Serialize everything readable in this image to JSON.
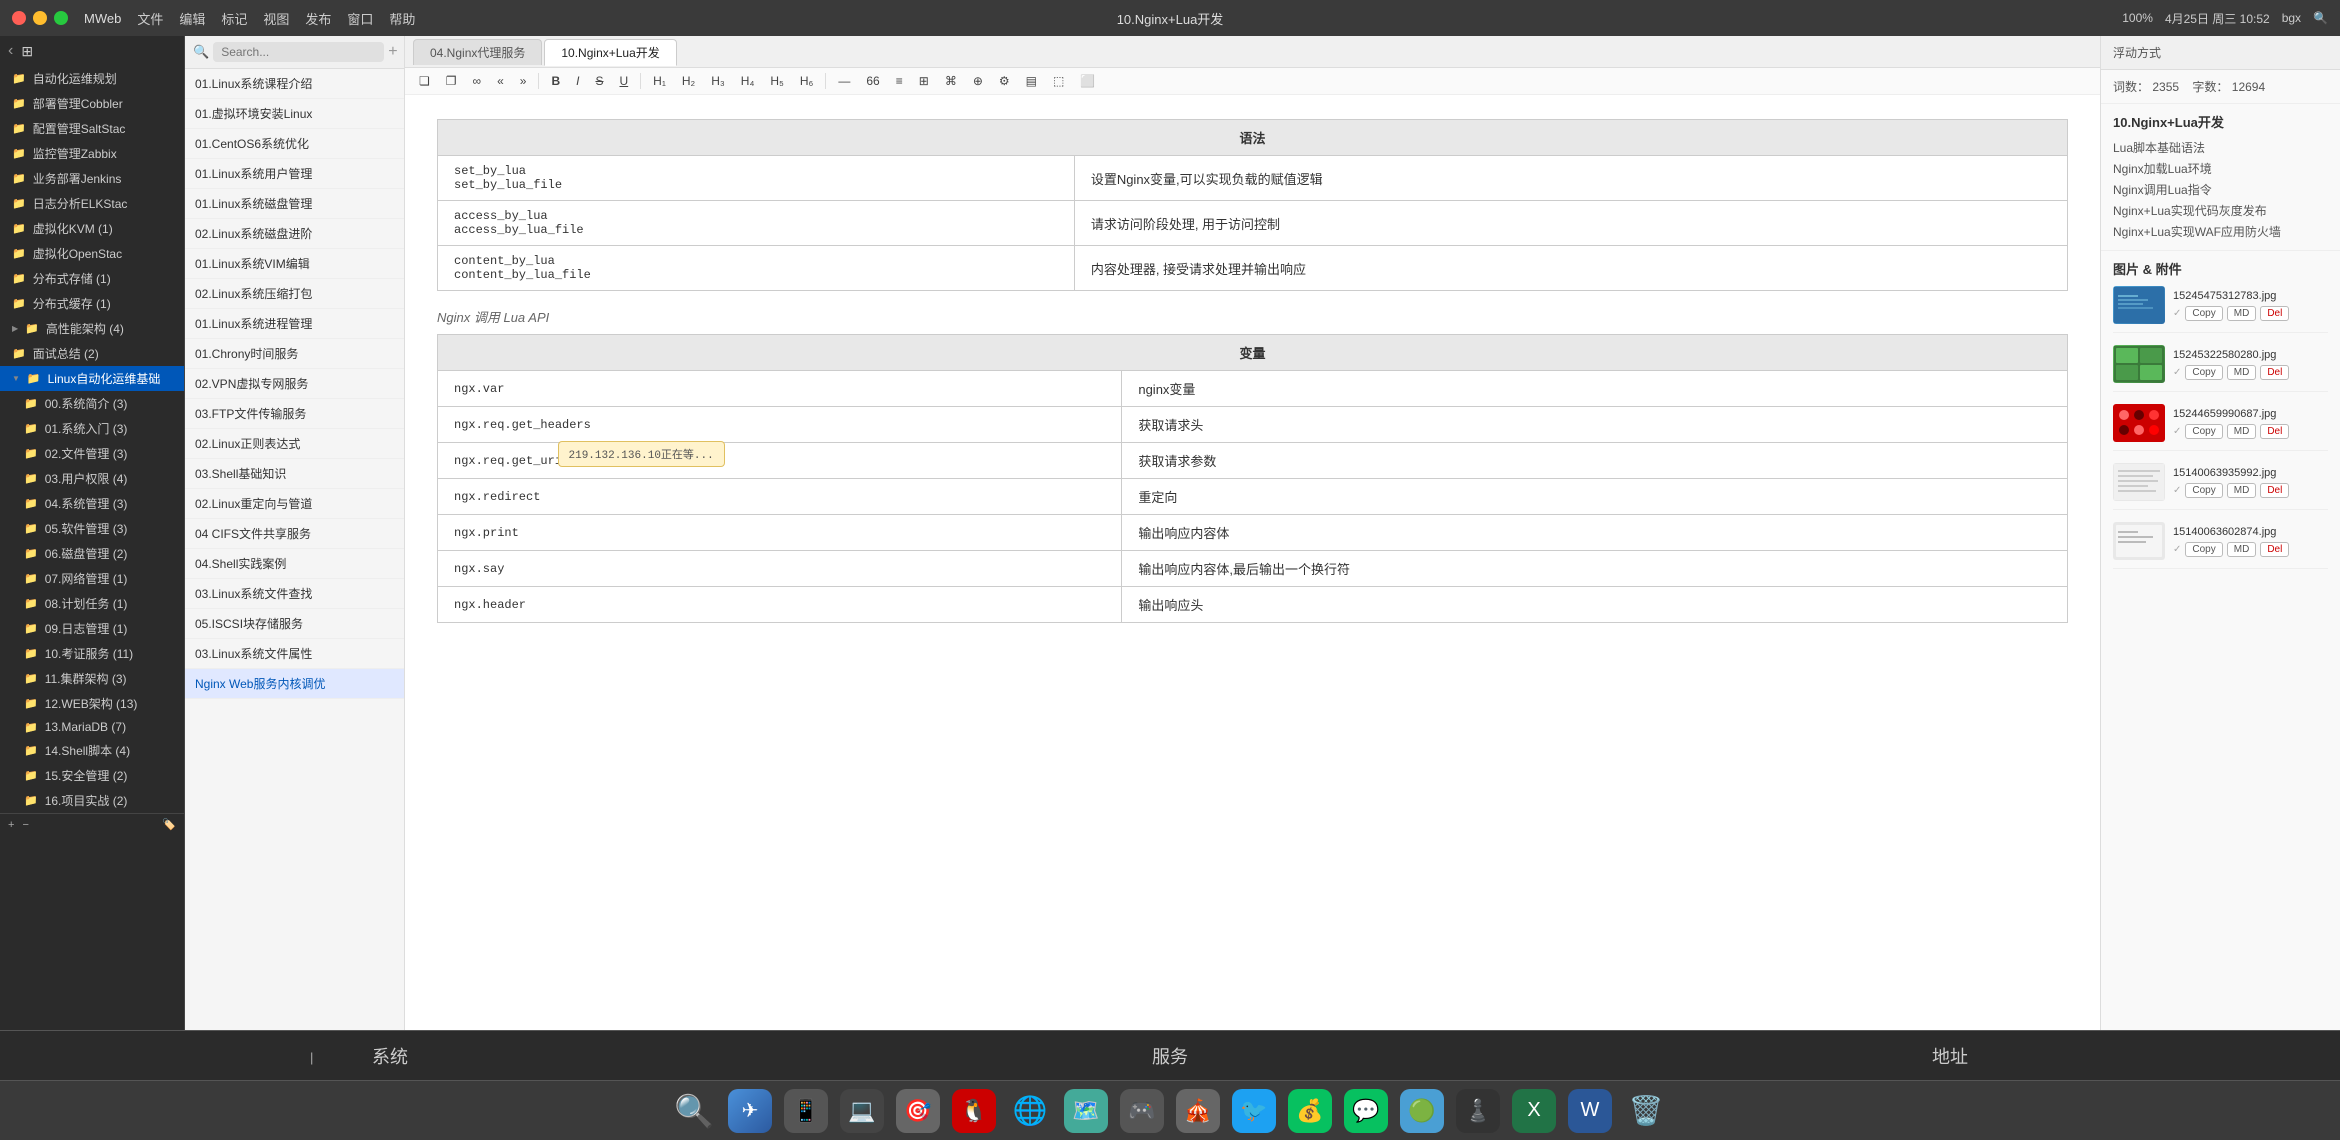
{
  "titleBar": {
    "appName": "MWeb",
    "menuItems": [
      "文件",
      "编辑",
      "标记",
      "视图",
      "发布",
      "窗口",
      "帮助"
    ],
    "windowTitle": "10.Nginx+Lua开发",
    "rightInfo": "100%",
    "dateTime": "4月25日 周三 10:52",
    "username": "bgx"
  },
  "sidebar": {
    "items": [
      {
        "label": "自动化运维规划",
        "indent": 1,
        "badge": ""
      },
      {
        "label": "部署管理Cobbler",
        "indent": 1,
        "badge": ""
      },
      {
        "label": "配置管理SaltStac",
        "indent": 1,
        "badge": ""
      },
      {
        "label": "监控管理Zabbix",
        "indent": 1,
        "badge": ""
      },
      {
        "label": "业务部署Jenkins",
        "indent": 1,
        "badge": ""
      },
      {
        "label": "日志分析ELKStac",
        "indent": 1,
        "badge": ""
      },
      {
        "label": "虚拟化KVM (1)",
        "indent": 1,
        "badge": ""
      },
      {
        "label": "虚拟化OpenStac",
        "indent": 1,
        "badge": ""
      },
      {
        "label": "分布式存储 (1)",
        "indent": 1,
        "badge": ""
      },
      {
        "label": "分布式缓存 (1)",
        "indent": 1,
        "badge": ""
      },
      {
        "label": "高性能架构 (4)",
        "indent": 1,
        "badge": "",
        "arrow": true
      },
      {
        "label": "面试总结 (2)",
        "indent": 1,
        "badge": ""
      },
      {
        "label": "Linux自动化运维基础",
        "indent": 1,
        "badge": "",
        "expanded": true,
        "active": true
      },
      {
        "label": "00.系统简介 (3)",
        "indent": 2,
        "badge": ""
      },
      {
        "label": "01.系统入门 (3)",
        "indent": 2,
        "badge": ""
      },
      {
        "label": "02.文件管理 (3)",
        "indent": 2,
        "badge": ""
      },
      {
        "label": "03.用户权限 (4)",
        "indent": 2,
        "badge": ""
      },
      {
        "label": "04.系统管理 (3)",
        "indent": 2,
        "badge": ""
      },
      {
        "label": "05.软件管理 (3)",
        "indent": 2,
        "badge": ""
      },
      {
        "label": "06.磁盘管理 (2)",
        "indent": 2,
        "badge": ""
      },
      {
        "label": "07.网络管理 (1)",
        "indent": 2,
        "badge": ""
      },
      {
        "label": "08.计划任务 (1)",
        "indent": 2,
        "badge": ""
      },
      {
        "label": "09.日志管理 (1)",
        "indent": 2,
        "badge": ""
      },
      {
        "label": "10.考证服务 (11)",
        "indent": 2,
        "badge": ""
      },
      {
        "label": "11.集群架构 (3)",
        "indent": 2,
        "badge": ""
      },
      {
        "label": "12.WEB架构 (13)",
        "indent": 2,
        "badge": ""
      },
      {
        "label": "13.MariaDB (7)",
        "indent": 2,
        "badge": ""
      },
      {
        "label": "14.Shell脚本 (4)",
        "indent": 2,
        "badge": ""
      },
      {
        "label": "15.安全管理 (2)",
        "indent": 2,
        "badge": ""
      },
      {
        "label": "16.项目实战 (2)",
        "indent": 2,
        "badge": ""
      }
    ],
    "addLabel": "+"
  },
  "fileList": {
    "searchPlaceholder": "Search...",
    "items": [
      "01.Linux系统课程介绍",
      "01.虚拟环境安装Linux",
      "01.CentOS6系统优化",
      "01.Linux系统用户管理",
      "01.Linux系统磁盘管理",
      "02.Linux系统磁盘进阶",
      "01.Linux系统VIM编辑",
      "02.Linux系统压缩打包",
      "01.Linux系统进程管理",
      "01.Chrony时间服务",
      "02.VPN虚拟专网服务",
      "03.FTP文件传输服务",
      "02.Linux正则表达式",
      "03.Shell基础知识",
      "02.Linux重定向与管道",
      "04 CIFS文件共享服务",
      "04.Shell实践案例",
      "03.Linux系统文件查找",
      "05.ISCSI块存储服务",
      "03.Linux系统文件属性",
      "Nginx Web服务内核调优"
    ]
  },
  "tabs": [
    {
      "label": "04.Nginx代理服务",
      "active": false
    },
    {
      "label": "10.Nginx+Lua开发",
      "active": true
    }
  ],
  "toolbar": {
    "buttons": [
      "❏",
      "❐",
      "∞",
      "«",
      "»",
      "B",
      "I",
      "S",
      "U",
      "H₁",
      "H₂",
      "H₃",
      "H₄",
      "H₅",
      "H₆",
      "—",
      "66",
      "≡",
      "⊞",
      "⌘",
      "⊕",
      "⚙",
      "▤",
      "⬚",
      "⬜"
    ]
  },
  "editor": {
    "floatingMode": "浮动方式",
    "sections": {
      "syntax": {
        "header": "语法",
        "rows": [
          {
            "code": "set_by_lua\nset_by_lua_file",
            "description": "设置Nginx变量,可以实现负载的赋值逻辑"
          },
          {
            "code": "access_by_lua\naccess_by_lua_file",
            "description": "请求访问阶段处理, 用于访问控制"
          },
          {
            "code": "content_by_lua\ncontent_by_lua_file",
            "description": "内容处理器, 接受请求处理并输出响应"
          }
        ]
      },
      "apiLabel": "Nginx 调用 Lua API",
      "variables": {
        "header": "变量",
        "rows": [
          {
            "code": "ngx.var",
            "description": "nginx变量"
          },
          {
            "code": "ngx.req.get_headers",
            "description": "获取请求头"
          },
          {
            "code": "ngx.req.get_uri_args",
            "description": "获取请求参数"
          },
          {
            "code": "ngx.redirect",
            "description": "重定向"
          },
          {
            "code": "ngx.print",
            "description": "输出响应内容体"
          },
          {
            "code": "ngx.say",
            "description": "输出响应内容体,最后输出一个换行符"
          },
          {
            "code": "ngx.header",
            "description": "输出响应头"
          }
        ]
      }
    },
    "tooltip": "219.132.136.10正在等..."
  },
  "rightPanel": {
    "floatingModeLabel": "浮动方式",
    "wordCount": {
      "label1": "词数：",
      "value1": "2355",
      "label2": "字数：",
      "value2": "12694"
    },
    "outline": {
      "title": "10.Nginx+Lua开发",
      "items": [
        "Lua脚本基础语法",
        "Nginx加载Lua环境",
        "Nginx调用Lua指令",
        "Nginx+Lua实现代码灰度发布",
        "Nginx+Lua实现WAF应用防火墙"
      ]
    },
    "attachments": {
      "title": "图片 & 附件",
      "items": [
        {
          "name": "15245475312783.jpg",
          "thumb": "blue",
          "actions": [
            "Copy",
            "MD",
            "Del"
          ]
        },
        {
          "name": "15245322580280.jpg",
          "thumb": "green",
          "actions": [
            "Copy",
            "MD",
            "Del"
          ]
        },
        {
          "name": "15244659990687.jpg",
          "thumb": "red",
          "actions": [
            "Copy",
            "MD",
            "Del"
          ]
        },
        {
          "name": "15140063935992.jpg",
          "thumb": "light",
          "actions": [
            "Copy",
            "MD",
            "Del"
          ]
        },
        {
          "name": "15140063602874.jpg",
          "thumb": "light2",
          "actions": [
            "Copy",
            "MD",
            "Del"
          ]
        }
      ]
    }
  },
  "bottomBar": {
    "items": [
      "系统",
      "服务",
      "地址"
    ]
  },
  "dock": {
    "icons": [
      "🔍",
      "✈️",
      "📱",
      "💻",
      "🎯",
      "🐧",
      "🌐",
      "🗺️",
      "🎮",
      "🎪",
      "🐦",
      "💰",
      "🔴",
      "📝",
      "🌟",
      "💬",
      "🟢",
      "♟️",
      "📊",
      "🗑️"
    ]
  }
}
